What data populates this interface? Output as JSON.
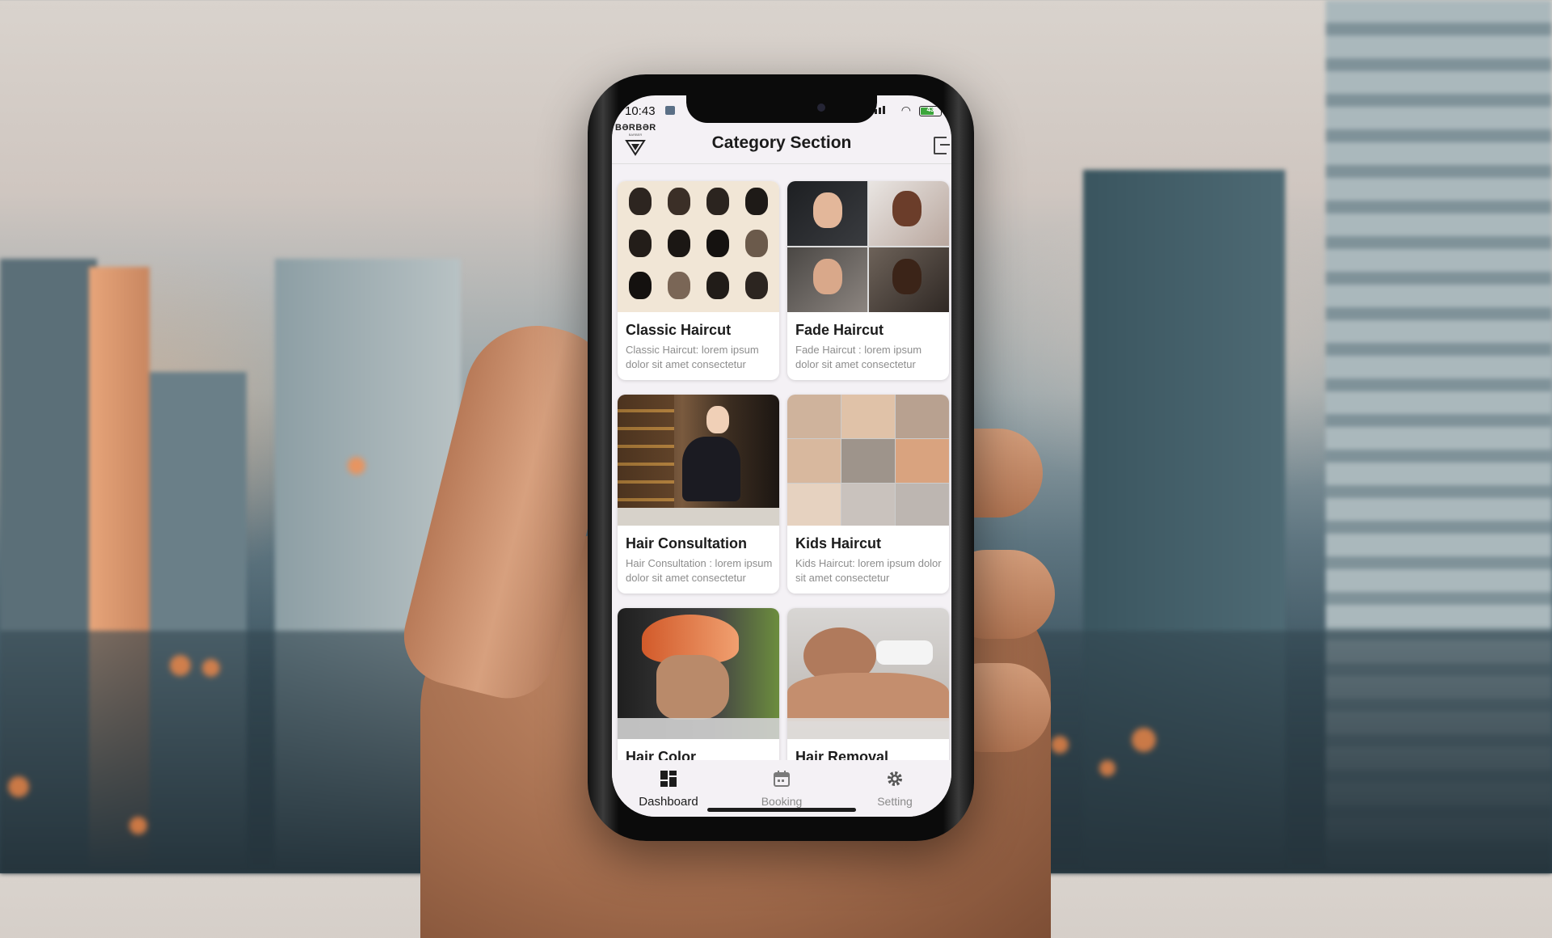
{
  "status_bar": {
    "time": "10:43",
    "battery": "43"
  },
  "app_bar": {
    "logo_text": "BƏRBƏR",
    "logo_sub": "BARBER",
    "title": "Category Section",
    "logout_icon": "logout-icon"
  },
  "categories": [
    {
      "name": "Classic Haircut",
      "description": "Classic Haircut: lorem ipsum dolor sit amet consectetur"
    },
    {
      "name": "Fade Haircut",
      "description": "Fade Haircut : lorem ipsum dolor sit amet consectetur"
    },
    {
      "name": "Hair Consultation",
      "description": "Hair Consultation : lorem ipsum dolor sit amet consectetur"
    },
    {
      "name": "Kids Haircut",
      "description": "Kids Haircut: lorem ipsum dolor sit amet consectetur"
    },
    {
      "name": "Hair Color",
      "description": ""
    },
    {
      "name": "Hair Removal",
      "description": ""
    }
  ],
  "bottom_nav": [
    {
      "label": "Dashboard",
      "icon": "dashboard-icon",
      "active": true
    },
    {
      "label": "Booking",
      "icon": "calendar-icon",
      "active": false
    },
    {
      "label": "Setting",
      "icon": "gear-icon",
      "active": false
    }
  ],
  "colors": {
    "active_nav": "#1c1c1c",
    "inactive_nav": "#8a8a8a",
    "screen_bg": "#f4f1f5"
  }
}
